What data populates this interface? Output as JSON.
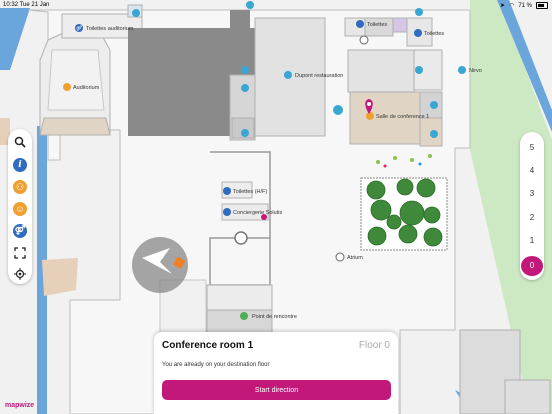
{
  "status_bar": {
    "time": "10:32",
    "date": "Tue 21 Jan",
    "battery": "71 %",
    "battery_level": 0.71
  },
  "map": {
    "labels": {
      "toilettes_auditorium": "Toilettes auditorium",
      "auditorium": "Auditorium",
      "dupont_restauration": "Dupont restauration",
      "toilettes_top": "Toilettes",
      "toilettes_right": "Toilettes",
      "nirvo": "Nirvo",
      "salle_conference": "Salle de conference 1",
      "toilettes_hf": "Toilettes (H/F)",
      "conciergerie": "Conciergerie Solutis",
      "atrium": "Atrium",
      "point_rencontre": "Point de rencontre"
    }
  },
  "toolbar": {
    "search_icon": "search-icon",
    "info_icon": "info-icon",
    "restaurant_icon": "restaurant-icon",
    "people_icon": "people-icon",
    "toilets_icon": "toilets-icon",
    "fullscreen_icon": "fullscreen-icon",
    "locate_icon": "locate-icon"
  },
  "floors": [
    "5",
    "4",
    "3",
    "2",
    "1",
    "0"
  ],
  "active_floor": "0",
  "destination_card": {
    "title": "Conference room 1",
    "floor": "Floor 0",
    "message": "You are already on your destination floor",
    "button_label": "Start direction"
  },
  "logo": "mapwize",
  "colors": {
    "accent": "#c2187a",
    "water": "#6aa6dc",
    "park": "#cde9c3"
  }
}
